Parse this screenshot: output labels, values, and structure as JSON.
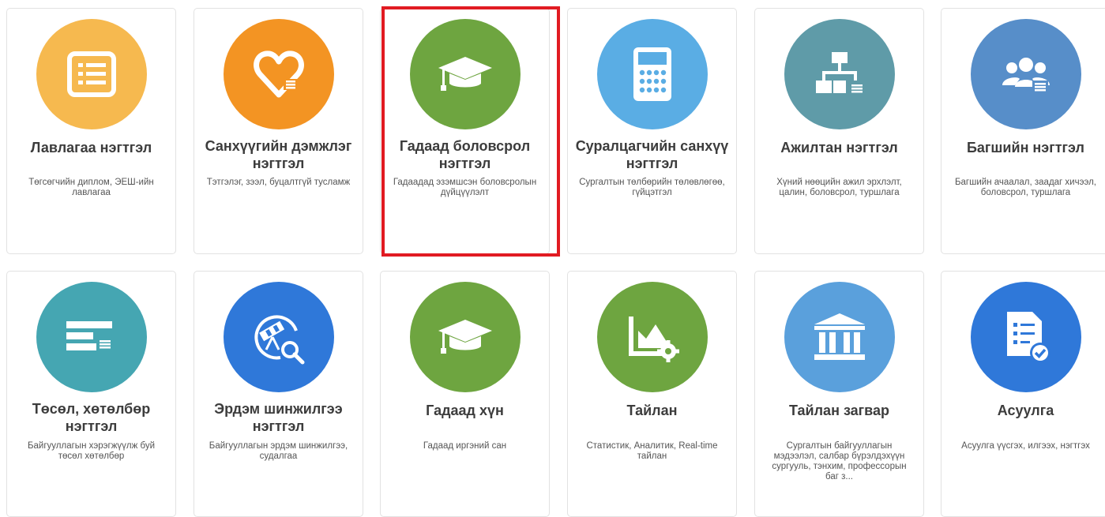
{
  "modules": [
    {
      "title": "Лавлагаа нэгтгэл",
      "description": "Төгсөгчийн диплом, ЭЕШ-ийн лавлагаа",
      "icon": "list-document-icon",
      "color": "#f6b94f"
    },
    {
      "title": "Санхүүгийн дэмжлэг нэгтгэл",
      "description": "Тэтгэлэг, зээл, буцалтгүй тусламж",
      "icon": "heart-support-icon",
      "color": "#f39423"
    },
    {
      "title": "Гадаад боловсрол нэгтгэл",
      "description": "Гадаадад эзэмшсэн боловсролын дүйцүүлэлт",
      "icon": "graduation-cap-icon",
      "color": "#6ea540"
    },
    {
      "title": "Суралцагчийн санхүү нэгтгэл",
      "description": "Сургалтын төлбөрийн төлөвлөгөө, гүйцэтгэл",
      "icon": "calculator-icon",
      "color": "#5aade4"
    },
    {
      "title": "Ажилтан нэгтгэл",
      "description": "Хүний нөөцийн ажил эрхлэлт, цалин, боловсрол, туршлага",
      "icon": "org-structure-icon",
      "color": "#5f9ba8"
    },
    {
      "title": "Багшийн нэгтгэл",
      "description": "Багшийн ачаалал, заадаг хичээл, боловсрол, туршлага",
      "icon": "teachers-group-icon",
      "color": "#578ec9"
    },
    {
      "title": "Төсөл, хөтөлбөр нэгтгэл",
      "description": "Байгууллагын хэрэгжүүлж буй төсөл хөтөлбөр",
      "icon": "project-list-icon",
      "color": "#45a6b2"
    },
    {
      "title": "Эрдэм шинжилгээ нэгтгэл",
      "description": "Байгууллагын эрдэм шинжилгээ, судалгаа",
      "icon": "telescope-search-icon",
      "color": "#2f78d9"
    },
    {
      "title": "Гадаад хүн",
      "description": "Гадаад иргэний сан",
      "icon": "graduation-cap-icon",
      "color": "#6ea540"
    },
    {
      "title": "Тайлан",
      "description": "Статистик, Аналитик, Real-time тайлан",
      "icon": "chart-gear-icon",
      "color": "#6ea540"
    },
    {
      "title": "Тайлан загвар",
      "description": "Сургалтын байгууллагын мэдээлэл, салбар бүрэлдэхүүн сургууль, тэнхим, профессорын баг з...",
      "icon": "institution-building-icon",
      "color": "#5aa0dc"
    },
    {
      "title": "Асуулга",
      "description": "Асуулга үүсгэх, илгээх, нэгтгэх",
      "icon": "survey-check-icon",
      "color": "#2f78d9"
    }
  ]
}
